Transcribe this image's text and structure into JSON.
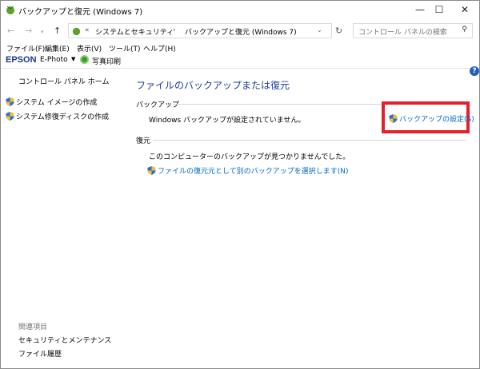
{
  "window": {
    "title": "バックアップと復元 (Windows 7)",
    "minimize": "—",
    "maximize": "☐",
    "close": "✕"
  },
  "address": {
    "prefix": "«",
    "crumbs": [
      "システムとセキュリティ",
      "バックアップと復元 (Windows 7)"
    ],
    "separator": "›",
    "search_placeholder": "コントロール パネルの検索"
  },
  "menu": [
    "ファイル(F)",
    "編集(E)",
    "表示(V)",
    "ツール(T)",
    "ヘルプ(H)"
  ],
  "epson": {
    "brand": "EPSON",
    "product": "E-Photo",
    "print": "写真印刷"
  },
  "sidebar": {
    "home": "コントロール パネル ホーム",
    "items": [
      "システム イメージの作成",
      "システム修復ディスクの作成"
    ],
    "related_title": "関連項目",
    "related": [
      "セキュリティとメンテナンス",
      "ファイル履歴"
    ]
  },
  "main": {
    "title": "ファイルのバックアップまたは復元",
    "backup": {
      "label": "バックアップ",
      "status": "Windows バックアップが設定されていません。",
      "link": "バックアップの設定(S)"
    },
    "restore": {
      "label": "復元",
      "status": "このコンピューターのバックアップが見つかりませんでした。",
      "link": "ファイルの復元元として別のバックアップを選択します(N)"
    }
  },
  "colors": {
    "link": "#0066cc",
    "title": "#1e3c96",
    "highlight": "#e5202a"
  }
}
